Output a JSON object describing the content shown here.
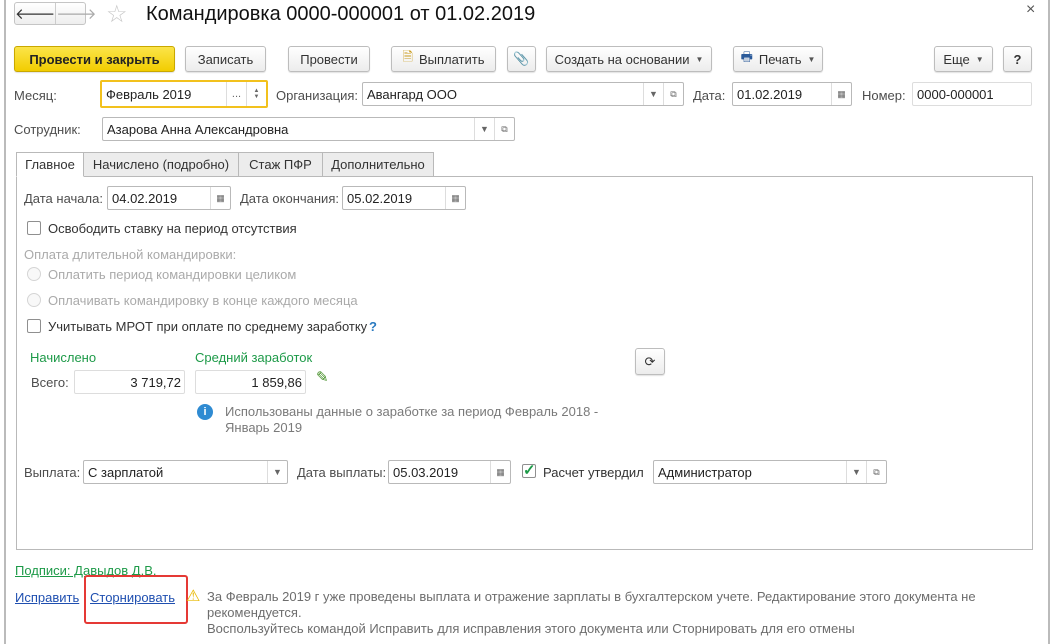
{
  "title": "Командировка 0000-000001 от 01.02.2019",
  "toolbar": {
    "post_close": "Провести и закрыть",
    "save": "Записать",
    "post": "Провести",
    "pay": "Выплатить",
    "create_based": "Создать на основании",
    "print": "Печать",
    "more": "Еще",
    "help": "?"
  },
  "header": {
    "month_label": "Месяц:",
    "month_value": "Февраль 2019",
    "month_btn": "...",
    "org_label": "Организация:",
    "org_value": "Авангард ООО",
    "date_label": "Дата:",
    "date_value": "01.02.2019",
    "number_label": "Номер:",
    "number_value": "0000-000001",
    "employee_label": "Сотрудник:",
    "employee_value": "Азарова Анна Александровна"
  },
  "tabs": [
    "Главное",
    "Начислено (подробно)",
    "Стаж ПФР",
    "Дополнительно"
  ],
  "main": {
    "start_label": "Дата начала:",
    "start_value": "04.02.2019",
    "end_label": "Дата окончания:",
    "end_value": "05.02.2019",
    "free_rate": "Освободить ставку на период отсутствия",
    "long_trip_label": "Оплата длительной командировки:",
    "radio1": "Оплатить период командировки целиком",
    "radio2": "Оплачивать командировку в конце каждого месяца",
    "mrot": "Учитывать МРОТ при оплате по среднему заработку",
    "mrot_help": "?",
    "accrued_label": "Начислено",
    "avg_label": "Средний заработок",
    "total_label": "Всего:",
    "total_value": "3 719,72",
    "avg_value": "1 859,86",
    "info_text_1": "Использованы данные о заработке за период Февраль 2018 -",
    "info_text_2": "Январь 2019",
    "payout_label": "Выплата:",
    "payout_value": "С зарплатой",
    "payout_date_label": "Дата выплаты:",
    "payout_date_value": "05.03.2019",
    "approved_label": "Расчет утвердил",
    "approved_checked": true,
    "approved_value": "Администратор"
  },
  "footer": {
    "signatures": "Подписи: Давыдов Д.В.",
    "fix": "Исправить",
    "reverse": "Сторнировать",
    "warning_1": "За Февраль 2019 г уже проведены выплата и отражение зарплаты в бухгалтерском учете. Редактирование этого документа не",
    "warning_2": "рекомендуется.",
    "warning_3": "Воспользуйтесь командой Исправить для исправления этого документа или Сторнировать для его отмены"
  },
  "colors": {
    "accent": "#f2cd00",
    "green": "#1d9a48",
    "link": "#1f4fb0",
    "highlight": "#e53935"
  }
}
